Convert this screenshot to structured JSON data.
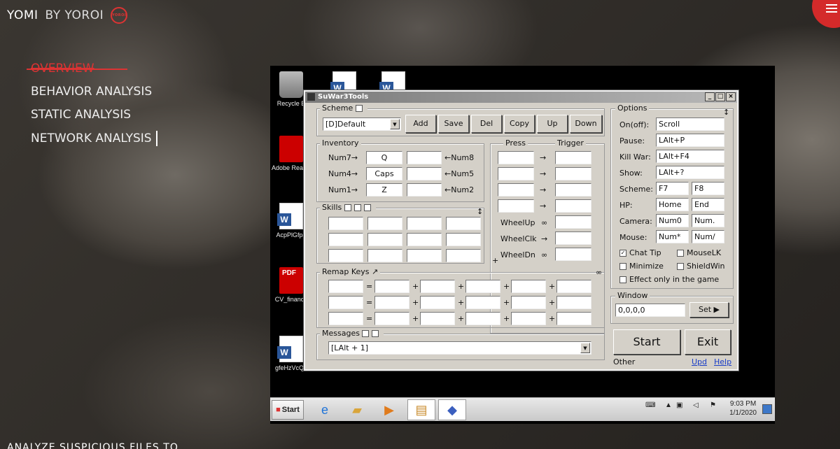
{
  "brand": {
    "name": "YOMI",
    "by": "BY YOROI",
    "logo": "YOROI"
  },
  "nav": [
    {
      "label": "OVERVIEW"
    },
    {
      "label": "BEHAVIOR ANALYSIS"
    },
    {
      "label": "STATIC ANALYSIS"
    },
    {
      "label": "NETWORK ANALYSIS"
    }
  ],
  "bottom_text": "ANALYZE SUSPICIOUS FILES TO",
  "desktop_icons": [
    "Recycle B",
    "Adobe Rea XI",
    "AcpPlGfpa",
    "CV_finance",
    "gfeHzVcQe"
  ],
  "window": {
    "title": "SuWar3Tools",
    "scheme": {
      "legend": "Scheme",
      "select": "[D]Default",
      "buttons": [
        "Add",
        "Save",
        "Del",
        "Copy",
        "Up",
        "Down"
      ]
    },
    "inventory": {
      "legend": "Inventory",
      "rows": [
        {
          "left": "Num7→",
          "key": "Q",
          "right": "←Num8"
        },
        {
          "left": "Num4→",
          "key": "Caps",
          "right": "←Num5"
        },
        {
          "left": "Num1→",
          "key": "Z",
          "right": "←Num2"
        }
      ]
    },
    "press_trigger": {
      "press": "Press",
      "trigger": "Trigger",
      "arrow": "→",
      "wheel": [
        "WheelUp",
        "WheelClk",
        "WheelDn"
      ],
      "wheel_sym": [
        "∞",
        "→",
        "∞"
      ],
      "plus": "+"
    },
    "skills": {
      "legend": "Skills",
      "mark": "↕"
    },
    "remap": {
      "legend": "Remap Keys",
      "arrow": "↗",
      "inf": "∞",
      "eq": "=",
      "plus": "+"
    },
    "messages": {
      "legend": "Messages",
      "select": "[LAlt + 1]"
    },
    "options": {
      "legend": "Options",
      "mark": "↕",
      "single": [
        {
          "label": "On(off):",
          "value": "Scroll"
        },
        {
          "label": "Pause:",
          "value": "LAlt+P"
        },
        {
          "label": "Kill War:",
          "value": "LAlt+F4"
        },
        {
          "label": "Show:",
          "value": "LAlt+?"
        }
      ],
      "double": [
        {
          "label": "Scheme:",
          "v1": "F7",
          "v2": "F8"
        },
        {
          "label": "HP:",
          "v1": "Home",
          "v2": "End"
        },
        {
          "label": "Camera:",
          "v1": "Num0",
          "v2": "Num."
        },
        {
          "label": "Mouse:",
          "v1": "Num*",
          "v2": "Num/"
        }
      ],
      "checks": [
        {
          "label": "Chat Tip",
          "checked": true
        },
        {
          "label": "MouseLK",
          "checked": false
        },
        {
          "label": "Minimize",
          "checked": false
        },
        {
          "label": "ShieldWin",
          "checked": false
        },
        {
          "label": "Effect only in the game",
          "checked": false
        }
      ]
    },
    "window_group": {
      "legend": "Window",
      "value": "0,0,0,0",
      "set": "Set ▶"
    },
    "start": "Start",
    "exit": "Exit",
    "other": "Other",
    "upd": "Upd",
    "help": "Help"
  },
  "taskbar": {
    "start": "Start",
    "time": "9:03 PM",
    "date": "1/1/2020"
  }
}
